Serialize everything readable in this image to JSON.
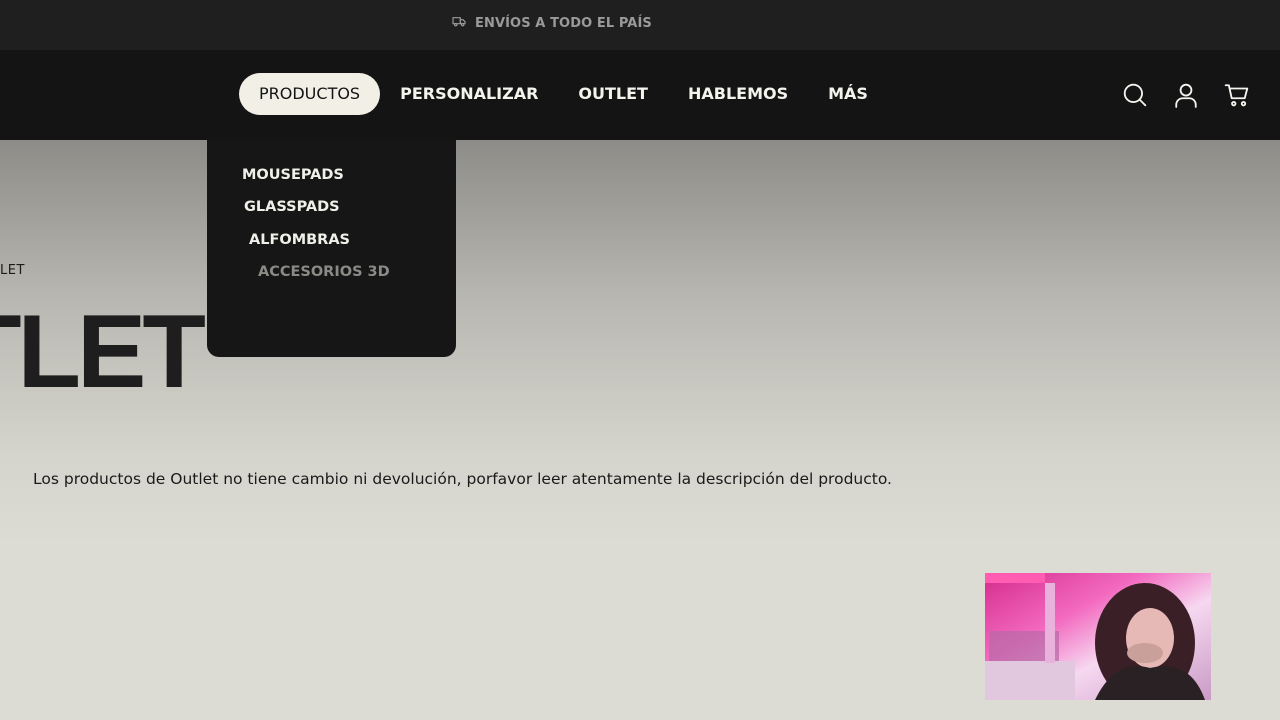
{
  "announcement": {
    "text": "ENVÍOS A TODO EL PAÍS",
    "icon": "truck-icon"
  },
  "nav": {
    "items": [
      {
        "label": "PRODUCTOS",
        "active": true
      },
      {
        "label": "PERSONALIZAR",
        "active": false
      },
      {
        "label": "OUTLET",
        "active": false
      },
      {
        "label": "HABLEMOS",
        "active": false
      },
      {
        "label": "MÁS",
        "active": false
      }
    ],
    "icons": [
      "search-icon",
      "account-icon",
      "cart-icon"
    ]
  },
  "dropdown": {
    "items": [
      {
        "label": "MOUSEPADS"
      },
      {
        "label": "GLASSPADS"
      },
      {
        "label": "ALFOMBRAS"
      },
      {
        "label": "ACCESORIOS 3D"
      }
    ]
  },
  "page": {
    "breadcrumb": "LET",
    "title": "TLET",
    "notice": "Los productos de Outlet no tiene cambio ni devolución, porfavor leer atentamente la descripción del producto."
  },
  "colors": {
    "header_bg": "#141414",
    "announce_bg": "#1f1f1f",
    "active_pill": "#f2f0e6",
    "page_bg": "#dcdcd4"
  }
}
